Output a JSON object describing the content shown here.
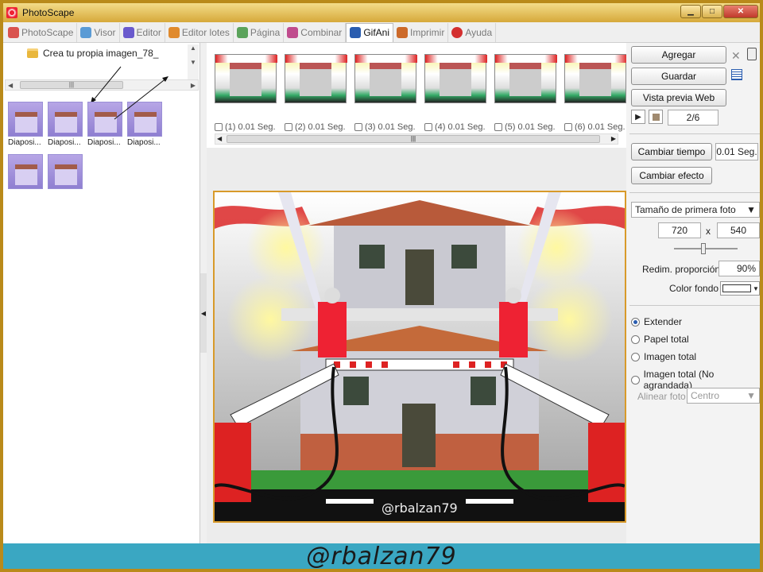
{
  "window": {
    "title": "PhotoScape"
  },
  "tabs": [
    {
      "label": "PhotoScape",
      "icon": "photoscape-icon",
      "color": "#d9534f"
    },
    {
      "label": "Visor",
      "icon": "viewer-icon",
      "color": "#5b9bd5"
    },
    {
      "label": "Editor",
      "icon": "editor-icon",
      "color": "#6a5acd"
    },
    {
      "label": "Editor lotes",
      "icon": "batch-editor-icon",
      "color": "#e08a2d"
    },
    {
      "label": "Página",
      "icon": "page-icon",
      "color": "#5ba35b"
    },
    {
      "label": "Combinar",
      "icon": "combine-icon",
      "color": "#c04c8e"
    },
    {
      "label": "GifAni",
      "icon": "gifani-icon",
      "color": "#2a5db0"
    },
    {
      "label": "Imprimir",
      "icon": "print-icon",
      "color": "#cc6a2a"
    },
    {
      "label": "Ayuda",
      "icon": "help-icon",
      "color": "#d32f2f"
    }
  ],
  "active_tab": "GifAni",
  "sidebar": {
    "folder_label": "Crea tu propia imagen_78_",
    "thumbnails": [
      "Diaposi...",
      "Diaposi...",
      "Diaposi...",
      "Diaposi...",
      "",
      ""
    ]
  },
  "frames": [
    {
      "index": "(1)",
      "time": "0.01 Seg."
    },
    {
      "index": "(2)",
      "time": "0.01 Seg."
    },
    {
      "index": "(3)",
      "time": "0.01 Seg."
    },
    {
      "index": "(4)",
      "time": "0.01 Seg."
    },
    {
      "index": "(5)",
      "time": "0.01 Seg."
    },
    {
      "index": "(6)",
      "time": "0.01 Seg."
    }
  ],
  "preview": {
    "watermark": "@rbalzan79"
  },
  "right_panel": {
    "add_label": "Agregar",
    "save_label": "Guardar",
    "web_preview_label": "Vista previa Web",
    "frame_counter": "2/6",
    "change_time_label": "Cambiar tiempo",
    "time_value": "0.01 Seg.",
    "change_effect_label": "Cambiar efecto",
    "size_select": "Tamaño de primera foto",
    "width": "720",
    "x_label": "x",
    "height": "540",
    "resize_label": "Redim. proporción",
    "resize_value": "90%",
    "bg_color_label": "Color fondo",
    "radios": [
      {
        "label": "Extender",
        "checked": true
      },
      {
        "label": "Papel total",
        "checked": false
      },
      {
        "label": "Imagen total",
        "checked": false
      },
      {
        "label": "Imagen total (No agrandada)",
        "checked": false
      }
    ],
    "align_label": "Alinear foto",
    "align_value": "Centro"
  },
  "footer": {
    "text": "@rbalzan79"
  }
}
